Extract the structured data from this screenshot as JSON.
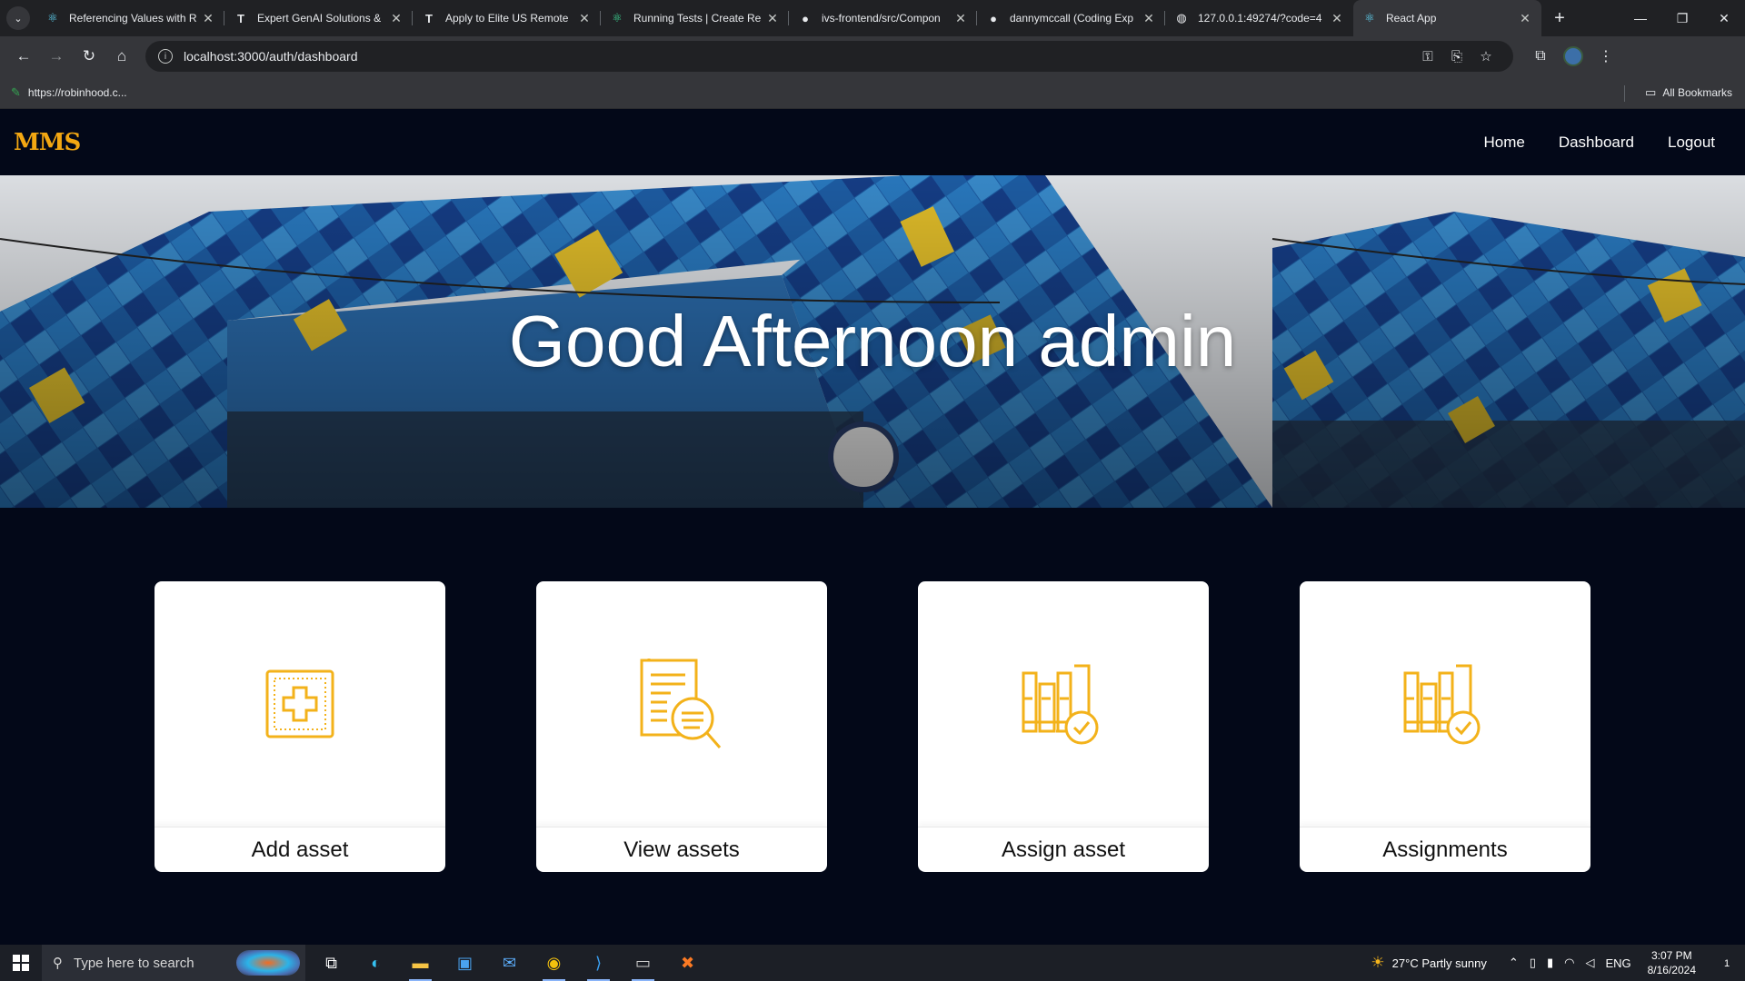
{
  "browser": {
    "tabs": [
      {
        "title": "Referencing Values with R",
        "favicon": "react-atom-icon"
      },
      {
        "title": "Expert GenAI Solutions &",
        "favicon": "t-logo-icon"
      },
      {
        "title": "Apply to Elite US Remote",
        "favicon": "t-logo-icon"
      },
      {
        "title": "Running Tests | Create Re",
        "favicon": "react-atom-icon"
      },
      {
        "title": "ivs-frontend/src/Compon",
        "favicon": "github-icon"
      },
      {
        "title": "dannymccall (Coding Exp",
        "favicon": "github-icon"
      },
      {
        "title": "127.0.0.1:49274/?code=4",
        "favicon": "globe-icon"
      },
      {
        "title": "React App",
        "favicon": "react-atom-icon",
        "active": true
      }
    ],
    "url": "localhost:3000/auth/dashboard",
    "bookmark": "https://robinhood.c...",
    "all_bookmarks": "All Bookmarks"
  },
  "app": {
    "logo": "MMS",
    "nav": [
      "Home",
      "Dashboard",
      "Logout"
    ],
    "greeting": "Good Afternoon admin",
    "cards": [
      {
        "label": "Add asset",
        "icon": "add-box-icon"
      },
      {
        "label": "View assets",
        "icon": "document-search-icon"
      },
      {
        "label": "Assign asset",
        "icon": "assign-check-icon"
      },
      {
        "label": "Assignments",
        "icon": "assignments-check-icon"
      }
    ],
    "accent": "#f3a712",
    "background": "#030818"
  },
  "taskbar": {
    "search_placeholder": "Type here to search",
    "weather": "27°C  Partly sunny",
    "lang": "ENG",
    "time": "3:07 PM",
    "date": "8/16/2024",
    "notification_count": "1"
  }
}
